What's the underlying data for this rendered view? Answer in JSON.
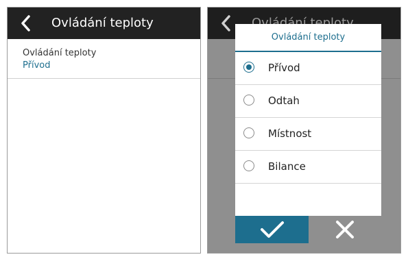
{
  "left_screen": {
    "header": {
      "title": "Ovládání teploty",
      "back_icon": "chevron-left-icon"
    },
    "setting": {
      "label": "Ovládání teploty",
      "value": "Přívod"
    }
  },
  "right_screen": {
    "header": {
      "title": "Ovládání teploty",
      "back_icon": "chevron-left-icon"
    },
    "dialog": {
      "title": "Ovládání teploty",
      "options": [
        {
          "label": "Přívod",
          "selected": true
        },
        {
          "label": "Odtah",
          "selected": false
        },
        {
          "label": "Místnost",
          "selected": false
        },
        {
          "label": "Bilance",
          "selected": false
        }
      ],
      "confirm_icon": "checkmark-icon",
      "cancel_icon": "close-icon"
    }
  },
  "colors": {
    "accent": "#1d6e8e",
    "header_bg": "#222222",
    "dim_overlay": "#8f8f8f"
  }
}
